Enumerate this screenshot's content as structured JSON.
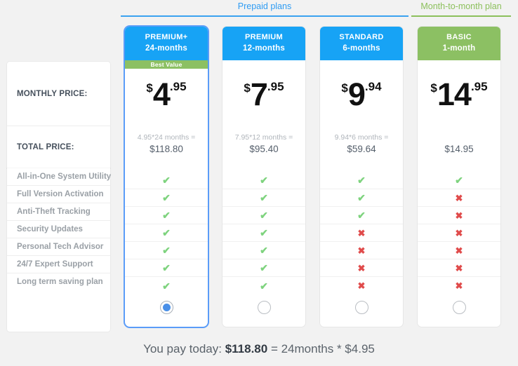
{
  "tabs": [
    {
      "label": "Prepaid plans",
      "active": true,
      "color": "#3ba2f0"
    },
    {
      "label": "Month-to-month plan",
      "active": false,
      "color": "#8cc05c"
    }
  ],
  "sidebar": {
    "monthly_price_label": "MONTHLY PRICE:",
    "total_price_label": "TOTAL PRICE:",
    "features": [
      "All-in-One System Utility",
      "Full Version Activation",
      "Anti-Theft Tracking",
      "Security Updates",
      "Personal Tech Advisor",
      "24/7 Expert Support",
      "Long term saving plan"
    ]
  },
  "plans": [
    {
      "name": "PREMIUM+",
      "term": "24-months",
      "header_color": "#17a3f5",
      "badge": "Best Value",
      "currency": "$",
      "price_whole": "4",
      "price_cents": ".95",
      "total_multiplier": "4.95*24 months =",
      "total_amount": "$118.80",
      "selected": true,
      "marks": [
        "check",
        "check",
        "check",
        "check",
        "check",
        "check",
        "check"
      ]
    },
    {
      "name": "PREMIUM",
      "term": "12-months",
      "header_color": "#17a3f5",
      "badge": "",
      "currency": "$",
      "price_whole": "7",
      "price_cents": ".95",
      "total_multiplier": "7.95*12 months =",
      "total_amount": "$95.40",
      "selected": false,
      "marks": [
        "check",
        "check",
        "check",
        "check",
        "check",
        "check",
        "check"
      ]
    },
    {
      "name": "STANDARD",
      "term": "6-months",
      "header_color": "#17a3f5",
      "badge": "",
      "currency": "$",
      "price_whole": "9",
      "price_cents": ".94",
      "total_multiplier": "9.94*6 months =",
      "total_amount": "$59.64",
      "selected": false,
      "marks": [
        "check",
        "check",
        "check",
        "cross",
        "cross",
        "cross",
        "cross"
      ]
    },
    {
      "name": "BASIC",
      "term": "1-month",
      "header_color": "#8cc063",
      "badge": "",
      "currency": "$",
      "price_whole": "14",
      "price_cents": ".95",
      "total_multiplier": "",
      "total_amount": "$14.95",
      "selected": false,
      "marks": [
        "check",
        "cross",
        "cross",
        "cross",
        "cross",
        "cross",
        "cross"
      ]
    }
  ],
  "footer": {
    "prefix": "You pay today: ",
    "amount": "$118.80",
    "suffix": " = 24months * $4.95"
  },
  "icons": {
    "check": "✔",
    "cross": "✖"
  },
  "colors": {
    "blue": "#17a3f5",
    "green": "#8cc063",
    "check": "#7ed37e",
    "cross": "#e04b4b",
    "selected_border": "#5a9cf8",
    "background": "#f2f2f2"
  }
}
